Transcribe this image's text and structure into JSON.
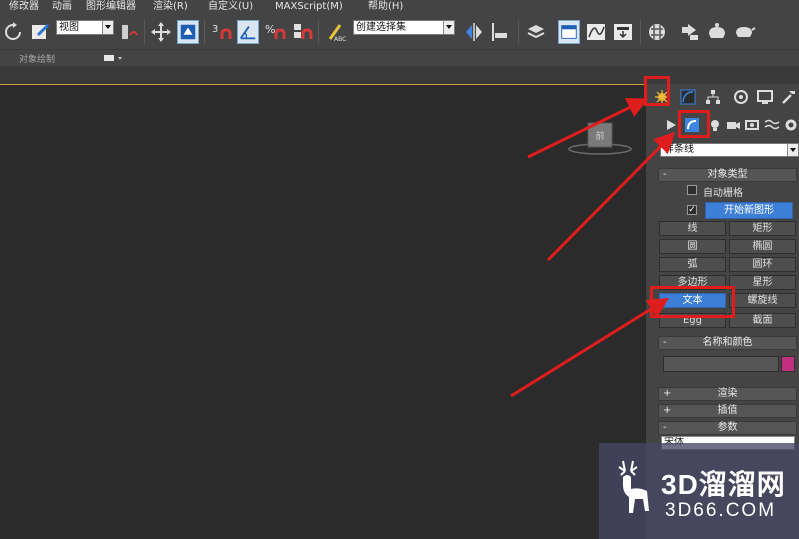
{
  "menubar": {
    "items": [
      "修改器",
      "动画",
      "图形编辑器",
      "渲染(R)",
      "自定义(U)",
      "MAXScript(M)",
      "帮助(H)"
    ]
  },
  "toolbar": {
    "view_dropdown": "视图",
    "selection_set_dropdown": "创建选择集"
  },
  "ribbon": {
    "label": "对象绘制"
  },
  "command_panel": {
    "category_dropdown": "样条线",
    "object_type": {
      "title": "对象类型",
      "autogrid_label": "自动栅格",
      "start_new_shape": "开始新图形",
      "start_new_shape_checked": "✓",
      "buttons": [
        [
          "线",
          "矩形"
        ],
        [
          "圆",
          "椭圆"
        ],
        [
          "弧",
          "圆环"
        ],
        [
          "多边形",
          "星形"
        ],
        [
          "文本",
          "螺旋线"
        ],
        [
          "Egg",
          "截面"
        ]
      ],
      "selected_button": "文本"
    },
    "name_color": {
      "title": "名称和颜色",
      "swatch_color": "#c0307e"
    },
    "rollouts": [
      {
        "title": "渲染",
        "sign": "+"
      },
      {
        "title": "插值",
        "sign": "+"
      },
      {
        "title": "参数",
        "sign": "-"
      }
    ],
    "param_field_text": "宋体"
  },
  "viewcube": {
    "label": "前"
  },
  "watermark": {
    "title": "3D溜溜网",
    "url": "3D66.COM"
  },
  "colors": {
    "annotation_red": "#e01d1d",
    "selected_blue": "#3d7fd6"
  }
}
